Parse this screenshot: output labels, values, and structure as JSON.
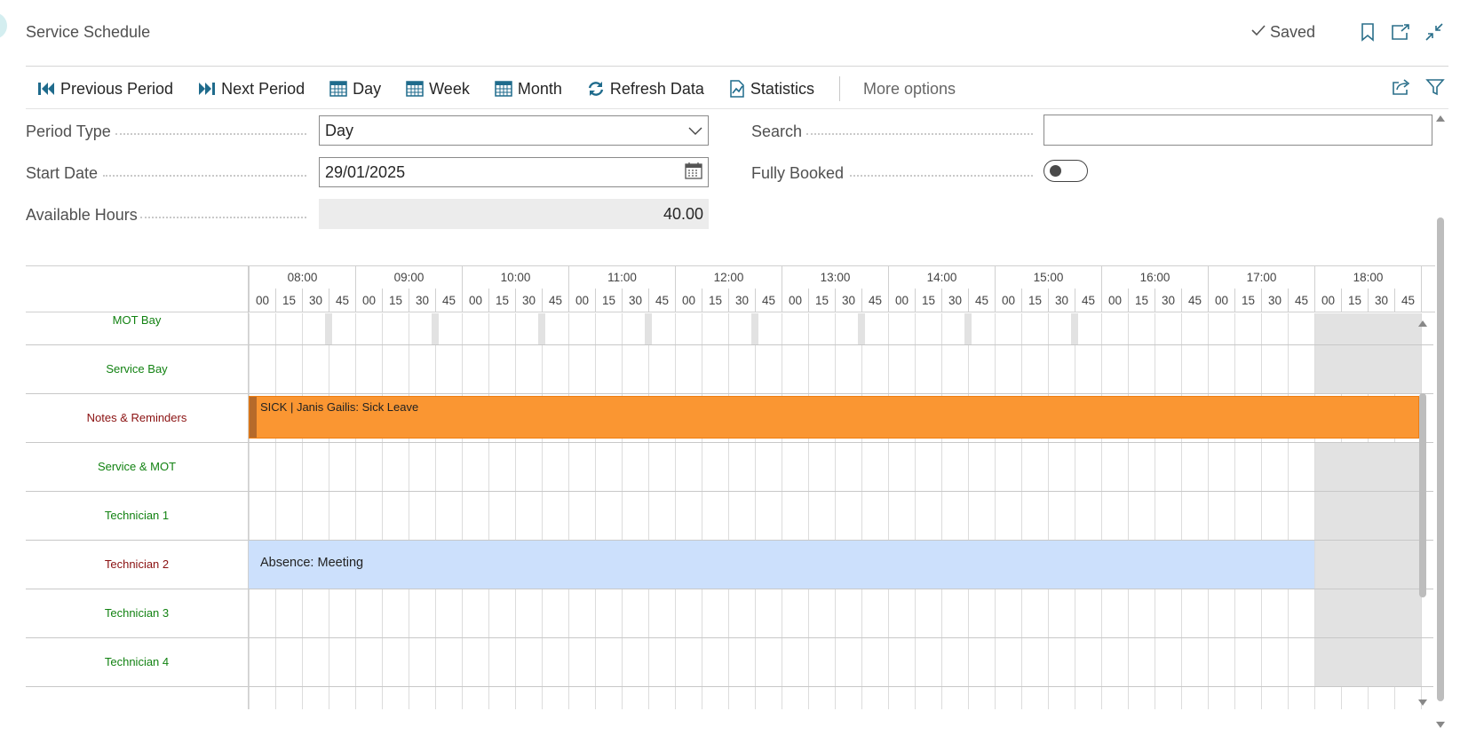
{
  "header": {
    "title": "Service Schedule",
    "saved_label": "Saved",
    "icons": [
      "checkmark-icon",
      "bookmark-icon",
      "open-new-window-icon",
      "collapse-icon"
    ]
  },
  "toolbar": {
    "previous_period": "Previous Period",
    "next_period": "Next Period",
    "day": "Day",
    "week": "Week",
    "month": "Month",
    "refresh_data": "Refresh Data",
    "statistics": "Statistics",
    "more_options": "More options",
    "right_icons": [
      "share-icon",
      "filter-icon"
    ]
  },
  "fields": {
    "period_type": {
      "label": "Period Type",
      "value": "Day"
    },
    "start_date": {
      "label": "Start Date",
      "value": "29/01/2025"
    },
    "available_hours": {
      "label": "Available Hours",
      "value": "40.00"
    },
    "search": {
      "label": "Search",
      "value": ""
    },
    "fully_booked": {
      "label": "Fully Booked",
      "value": false
    }
  },
  "schedule": {
    "hours": [
      "08:00",
      "09:00",
      "10:00",
      "11:00",
      "12:00",
      "13:00",
      "14:00",
      "15:00",
      "16:00",
      "17:00",
      "18:00"
    ],
    "minutes": [
      "00",
      "15",
      "30",
      "45"
    ],
    "rows": [
      {
        "label": "MOT Bay",
        "color": "#128212"
      },
      {
        "label": "Service Bay",
        "color": "#128212"
      },
      {
        "label": "Notes & Reminders",
        "color": "#8a1010"
      },
      {
        "label": "Service & MOT",
        "color": "#128212"
      },
      {
        "label": "Technician 1",
        "color": "#128212"
      },
      {
        "label": "Technician 2",
        "color": "#8a1010"
      },
      {
        "label": "Technician 3",
        "color": "#128212"
      },
      {
        "label": "Technician 4",
        "color": "#128212"
      }
    ],
    "events": {
      "sick": {
        "row": "Notes & Reminders",
        "text": "SICK | Janis Gailis: Sick Leave",
        "color": "#fa9632"
      },
      "absence": {
        "row": "Technician 2",
        "text": "Absence: Meeting",
        "color": "#cce0fc"
      }
    }
  }
}
